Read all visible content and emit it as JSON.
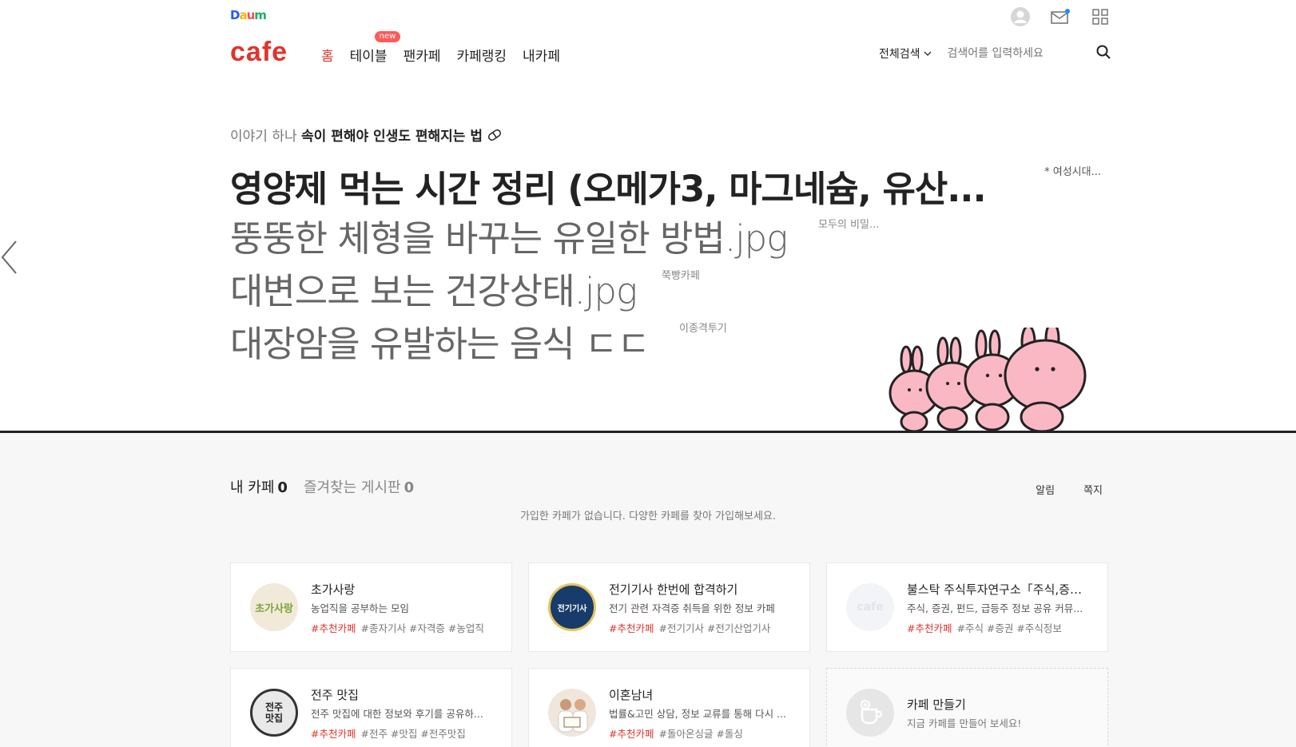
{
  "header": {
    "daum_logo": [
      "D",
      "a",
      "u",
      "m"
    ],
    "cafe_logo": "cafe",
    "nav": [
      {
        "label": "홈",
        "active": true
      },
      {
        "label": "테이블",
        "badge": "new"
      },
      {
        "label": "팬카페"
      },
      {
        "label": "카페랭킹"
      },
      {
        "label": "내카페"
      }
    ],
    "search": {
      "scope": "전체검색",
      "placeholder": "검색어를 입력하세요"
    },
    "icons": [
      "profile-icon",
      "mail-icon",
      "apps-grid-icon"
    ]
  },
  "hero": {
    "subtitle_prefix": "이야기 하나",
    "subtitle_bold": "속이 편해야 인생도 편해지는 법",
    "main_title": "영양제 먹는 시간 정리 (오메가3, 마그네슘, 유산...",
    "main_source": "* 여성시대...",
    "stories": [
      {
        "title": "뚱뚱한 체형을 바꾸는 유일한 방법.jpg",
        "source": "모두의 비밀..."
      },
      {
        "title": "대변으로 보는 건강상태.jpg",
        "source": "쭉빵카페"
      },
      {
        "title": "대장암을 유발하는 음식 ㄷㄷ",
        "source": "이종격투기"
      }
    ]
  },
  "mycafe": {
    "tab_mycafe": "내 카페",
    "tab_mycafe_count": "0",
    "tab_fav": "즐겨찾는 게시판",
    "tab_fav_count": "0",
    "action_alarm": "알림",
    "action_note": "쪽지",
    "empty_message": "가입한 카페가 없습니다. 다양한 카페를 찾아 가입해보세요."
  },
  "cafes": [
    {
      "name": "초가사랑",
      "desc": "농업직을 공부하는 모임",
      "rec": "#추천카페",
      "tags": "#종자기사 #자격증 #농업직",
      "thumb_text": "초가사랑"
    },
    {
      "name": "전기기사 한번에 합격하기",
      "desc": "전기 관련 자격증 취득을 위한 정보 카페",
      "rec": "#추천카페",
      "tags": "#전기기사 #전기산업기사",
      "thumb_text": "전기기사"
    },
    {
      "name": "불스탁 주식투자연구소「주식,증권,...",
      "desc": "주식, 증권, 펀드, 급등주 정보 공유 커뮤...",
      "rec": "#추천카페",
      "tags": "#주식 #증권 #주식정보",
      "thumb_text": "cafe"
    },
    {
      "name": "전주 맛집",
      "desc": "전주 맛집에 대한 정보와 후기를 공유하...",
      "rec": "#추천카페",
      "tags": "#전주 #맛집 #전주맛집",
      "thumb_text": "전주 맛집"
    },
    {
      "name": "이혼남녀",
      "desc": "법률&고민 상담, 정보 교류를 통해 다시 ...",
      "rec": "#추천카페",
      "tags": "#돌아온싱글 #돌싱",
      "thumb_text": ""
    }
  ],
  "make_cafe": {
    "title": "카페 만들기",
    "desc": "지금 카페를 만들어 보세요!"
  },
  "colors": {
    "brand_red": "#e0342c",
    "badge_red": "#ff5a5a",
    "bg_gray": "#f7f7f7"
  }
}
